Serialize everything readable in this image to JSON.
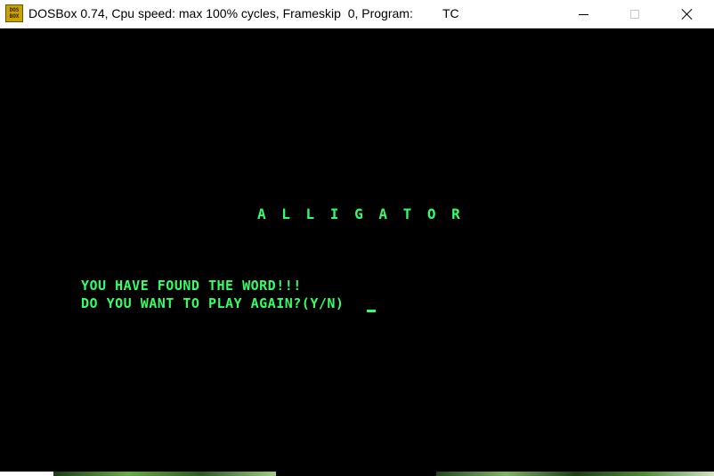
{
  "window": {
    "title": "DOSBox 0.74, Cpu speed: max 100% cycles, Frameskip  0, Program:",
    "program": "TC",
    "icon_label_top": "DOS",
    "icon_label_bottom": "BOX"
  },
  "controls": {
    "minimize_icon": "minimize-icon",
    "maximize_icon": "maximize-icon",
    "close_icon": "close-icon"
  },
  "game": {
    "word": "A L L I G A T O R",
    "message": "YOU HAVE FOUND THE WORD!!!",
    "prompt": "DO YOU WANT TO PLAY AGAIN?(Y/N)"
  },
  "colors": {
    "screen_bg": "#000000",
    "text_green": "#33ff66",
    "titlebar_bg": "#ffffff"
  }
}
